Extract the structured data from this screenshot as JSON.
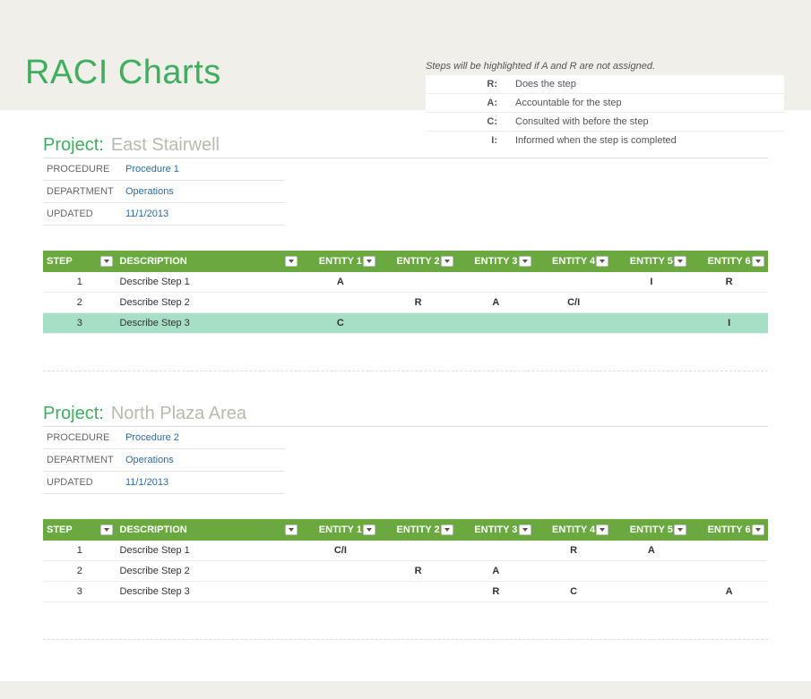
{
  "hint": "Steps will be highlighted if A and R are not assigned.",
  "legend": [
    {
      "key": "R:",
      "val": "Does the step"
    },
    {
      "key": "A:",
      "val": "Accountable for the step"
    },
    {
      "key": "C:",
      "val": "Consulted with before the step"
    },
    {
      "key": "I:",
      "val": "Informed when the step is completed"
    }
  ],
  "title": "RACI Charts",
  "projectLabel": "Project:",
  "metaLabels": {
    "procedure": "PROCEDURE",
    "department": "DEPARTMENT",
    "updated": "UPDATED"
  },
  "columns": {
    "step": "STEP",
    "desc": "DESCRIPTION",
    "entities": [
      "ENTITY 1",
      "ENTITY 2",
      "ENTITY 3",
      "ENTITY 4",
      "ENTITY 5",
      "ENTITY 6"
    ]
  },
  "projects": [
    {
      "name": "East Stairwell",
      "procedure": "Procedure 1",
      "department": "Operations",
      "updated": "11/1/2013",
      "steps": [
        {
          "n": "1",
          "desc": "Describe Step 1",
          "e": [
            "A",
            "",
            "",
            "",
            "I",
            "R"
          ],
          "hl": false
        },
        {
          "n": "2",
          "desc": "Describe Step 2",
          "e": [
            "",
            "R",
            "A",
            "C/I",
            "",
            ""
          ],
          "hl": false
        },
        {
          "n": "3",
          "desc": "Describe Step 3",
          "e": [
            "C",
            "",
            "",
            "",
            "",
            "I"
          ],
          "hl": true
        }
      ]
    },
    {
      "name": "North Plaza Area",
      "procedure": "Procedure 2",
      "department": "Operations",
      "updated": "11/1/2013",
      "steps": [
        {
          "n": "1",
          "desc": "Describe Step 1",
          "e": [
            "C/I",
            "",
            "",
            "R",
            "A",
            ""
          ],
          "hl": false
        },
        {
          "n": "2",
          "desc": "Describe Step 2",
          "e": [
            "",
            "R",
            "A",
            "",
            "",
            ""
          ],
          "hl": false
        },
        {
          "n": "3",
          "desc": "Describe Step 3",
          "e": [
            "",
            "",
            "R",
            "C",
            "",
            "A"
          ],
          "hl": false
        }
      ]
    }
  ]
}
